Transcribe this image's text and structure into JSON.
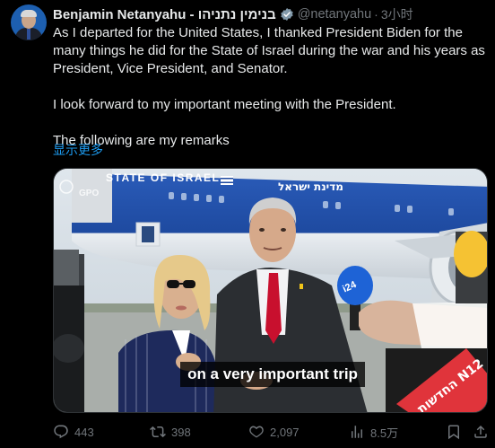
{
  "post": {
    "author_name": "Benjamin Netanyahu - בנימין נתניהו",
    "handle": "@netanyahu",
    "separator": "·",
    "time": "3小时",
    "more_glyph": "···",
    "paragraphs": [
      "As I departed for the United States, I thanked President Biden for the many things he did for the State of Israel during the war and his years as President, Vice  President, and Senator.",
      "I look forward to my important meeting with the President.",
      "The following are my remarks"
    ],
    "show_more": "显示更多",
    "media": {
      "caption": "on a very important trip",
      "airplane_text": "STATE OF ISRAEL",
      "airplane_hebrew": "מדינת ישראל",
      "watermark": "GPO",
      "mic_label": "i24",
      "mic_label_2": "החדשות N12"
    },
    "stats": {
      "replies": "443",
      "reposts": "398",
      "likes": "2,097",
      "views": "8.5万"
    }
  },
  "colors": {
    "background": "#000000",
    "text": "#e7e9ea",
    "muted": "#71767b",
    "link": "#1d9bf0",
    "verified_gray": "#829aab"
  },
  "icons": [
    "reply-icon",
    "repost-icon",
    "like-icon",
    "views-icon",
    "bookmark-icon",
    "share-icon",
    "verified-badge-icon"
  ]
}
